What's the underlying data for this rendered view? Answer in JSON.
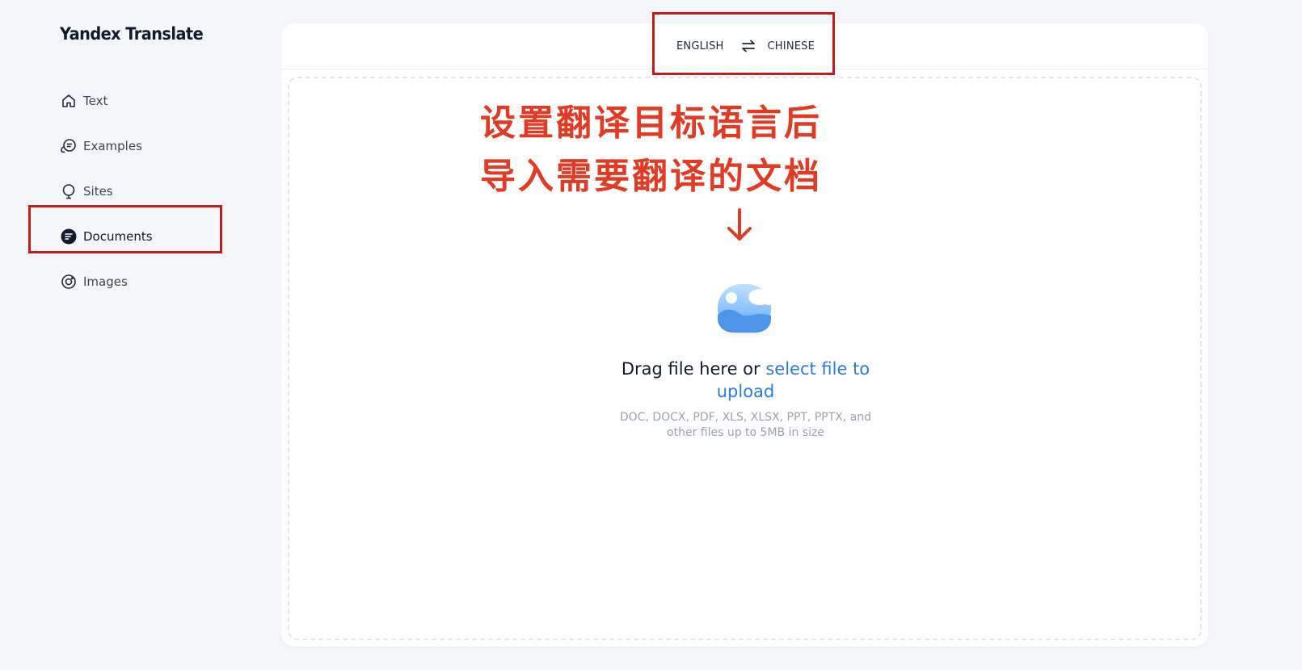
{
  "app": {
    "title": "Yandex Translate"
  },
  "sidebar": {
    "items": [
      {
        "label": "Text",
        "icon": "home-icon"
      },
      {
        "label": "Examples",
        "icon": "chat-bubble-icon"
      },
      {
        "label": "Sites",
        "icon": "globe-icon"
      },
      {
        "label": "Documents",
        "icon": "document-icon",
        "active": true
      },
      {
        "label": "Images",
        "icon": "camera-icon"
      }
    ]
  },
  "languages": {
    "source": "ENGLISH",
    "target": "CHINESE",
    "swap_icon": "swap-arrows-icon"
  },
  "annotation": {
    "line1": "设置翻译目标语言后",
    "line2": "导入需要翻译的文档",
    "color": "#e03b24",
    "highlight_color": "#c01c1c"
  },
  "upload": {
    "title_prefix": "Drag file here or ",
    "title_link": "select file to upload",
    "hint": "DOC, DOCX, PDF, XLS, XLSX, PPT, PPTX, and other files up to 5MB in size",
    "link_color": "#2a7ae2"
  }
}
